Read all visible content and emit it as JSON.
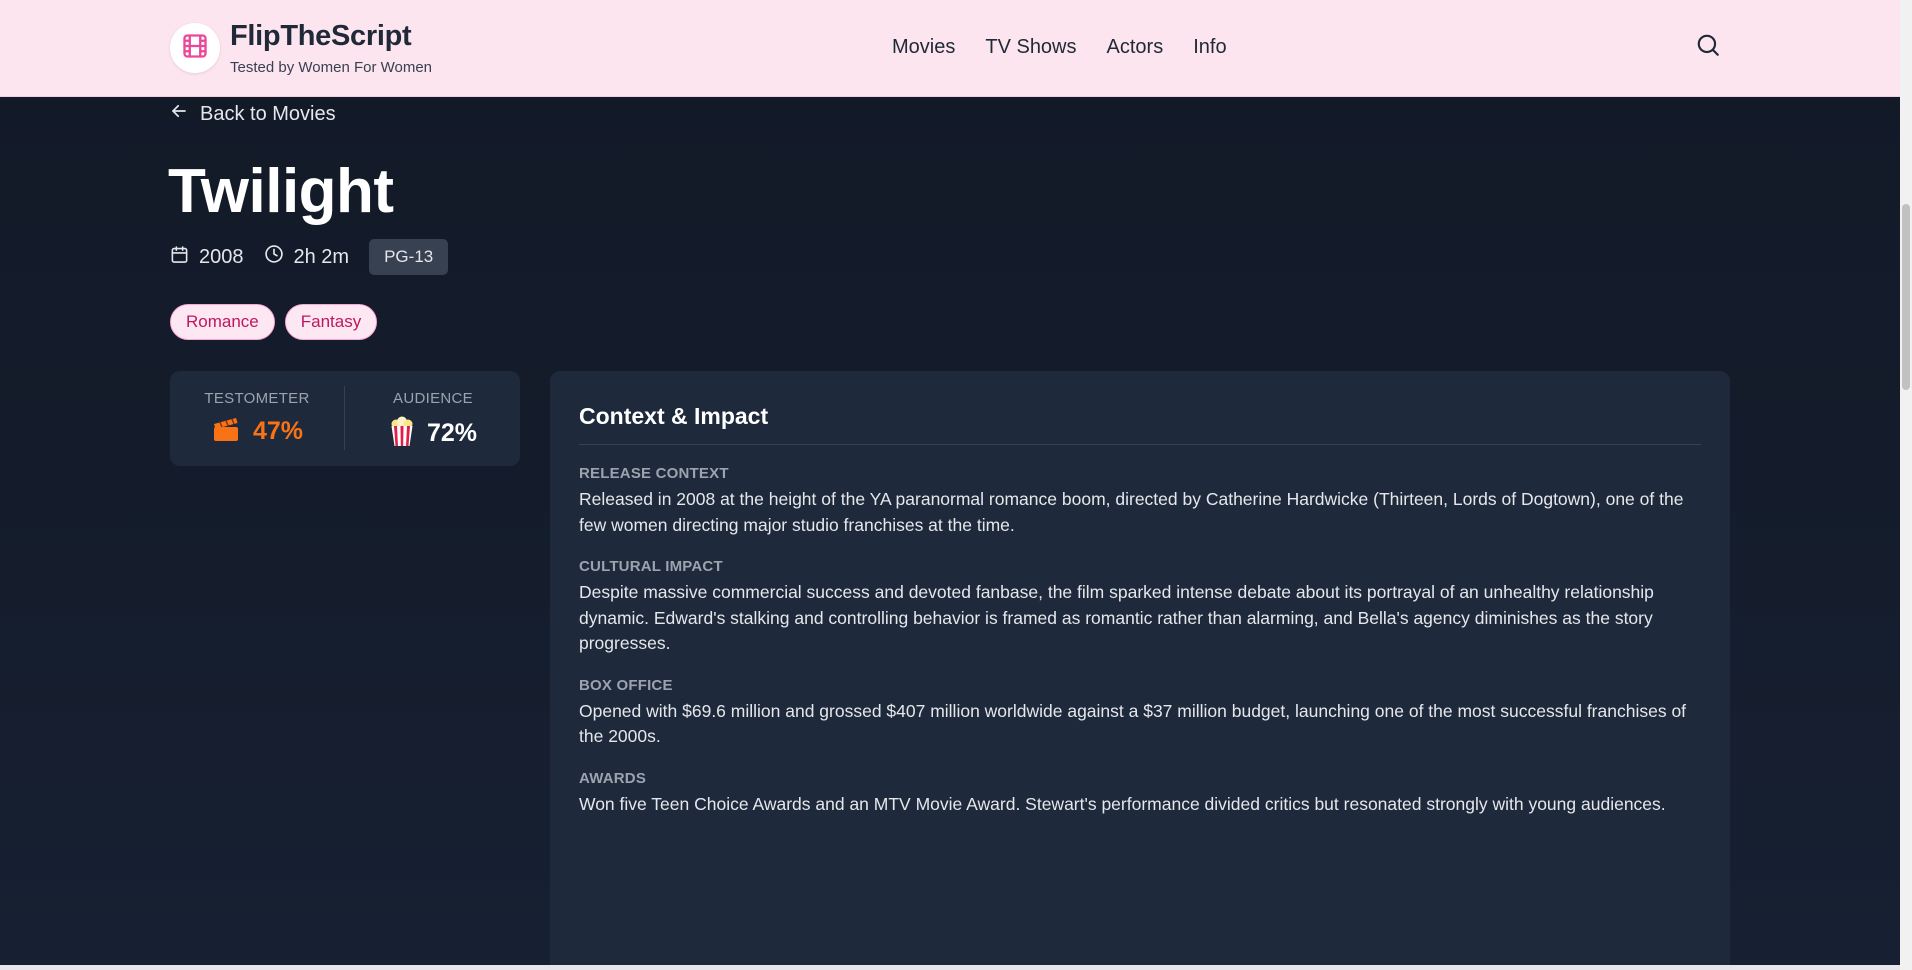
{
  "header": {
    "brand_name": "FlipTheScript",
    "tagline": "Tested by Women For Women",
    "nav": [
      {
        "label": "Movies"
      },
      {
        "label": "TV Shows"
      },
      {
        "label": "Actors"
      },
      {
        "label": "Info"
      }
    ]
  },
  "back_link": {
    "label": "Back to Movies"
  },
  "movie": {
    "title": "Twilight",
    "year": "2008",
    "runtime": "2h 2m",
    "rating": "PG-13",
    "genres": [
      "Romance",
      "Fantasy"
    ]
  },
  "scores": {
    "testometer": {
      "label": "TESTOMETER",
      "value": "47%",
      "icon": "clapperboard-icon",
      "color": "#f97316"
    },
    "audience": {
      "label": "AUDIENCE",
      "value": "72%",
      "icon": "popcorn-icon",
      "color": "#ffffff"
    }
  },
  "context": {
    "title": "Context & Impact",
    "sections": [
      {
        "label": "RELEASE CONTEXT",
        "text": "Released in 2008 at the height of the YA paranormal romance boom, directed by Catherine Hardwicke (Thirteen, Lords of Dogtown), one of the few women directing major studio franchises at the time."
      },
      {
        "label": "CULTURAL IMPACT",
        "text": "Despite massive commercial success and devoted fanbase, the film sparked intense debate about its portrayal of an unhealthy relationship dynamic. Edward's stalking and controlling behavior is framed as romantic rather than alarming, and Bella's agency diminishes as the story progresses."
      },
      {
        "label": "BOX OFFICE",
        "text": "Opened with $69.6 million and grossed $407 million worldwide against a $37 million budget, launching one of the most successful franchises of the 2000s."
      },
      {
        "label": "AWARDS",
        "text": "Won five Teen Choice Awards and an MTV Movie Award. Stewart's performance divided critics but resonated strongly with young audiences."
      }
    ]
  },
  "colors": {
    "header_bg": "#fde5f0",
    "page_bg": "#111827",
    "card_bg": "#1e293b",
    "accent_pink": "#ec4899",
    "testometer_orange": "#f97316"
  }
}
